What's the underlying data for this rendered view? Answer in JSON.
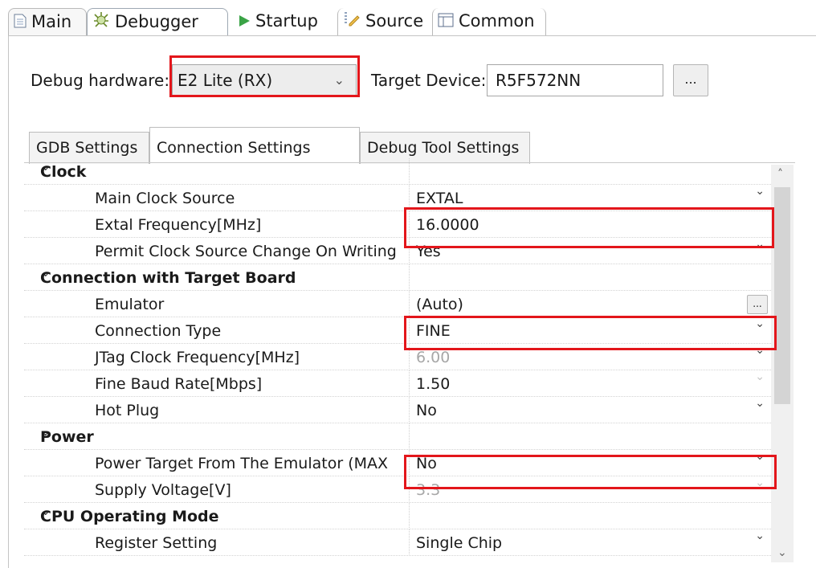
{
  "top_tabs": [
    {
      "label": "Main",
      "icon": "document-icon"
    },
    {
      "label": "Debugger",
      "icon": "bug-icon"
    },
    {
      "label": "Startup",
      "icon": "play-icon"
    },
    {
      "label": "Source",
      "icon": "source-icon"
    },
    {
      "label": "Common",
      "icon": "table-icon"
    }
  ],
  "debug_hardware": {
    "label": "Debug hardware:",
    "value": "E2 Lite (RX)"
  },
  "target_device": {
    "label": "Target Device:",
    "value": "R5F572NN",
    "browse": "..."
  },
  "sub_tabs": [
    "GDB Settings",
    "Connection Settings",
    "Debug Tool Settings"
  ],
  "properties": {
    "clock": {
      "label": "Clock",
      "main_clock_source": {
        "name": "Main Clock Source",
        "value": "EXTAL"
      },
      "extal_frequency": {
        "name": "Extal Frequency[MHz]",
        "value": "16.0000"
      },
      "permit_clock_change": {
        "name": "Permit Clock Source Change On Writing",
        "value": "Yes"
      }
    },
    "connection": {
      "label": "Connection with Target Board",
      "emulator": {
        "name": "Emulator",
        "value": "(Auto)",
        "browse": "..."
      },
      "connection_type": {
        "name": "Connection Type",
        "value": "FINE"
      },
      "jtag_clock": {
        "name": "JTag Clock Frequency[MHz]",
        "value": "6.00"
      },
      "fine_baud": {
        "name": "Fine Baud Rate[Mbps]",
        "value": "1.50"
      },
      "hot_plug": {
        "name": "Hot Plug",
        "value": "No"
      }
    },
    "power": {
      "label": "Power",
      "power_target": {
        "name": "Power Target From The Emulator (MAX",
        "value": "No"
      },
      "supply_voltage": {
        "name": "Supply Voltage[V]",
        "value": "3.3"
      }
    },
    "cpu_mode": {
      "label": "CPU Operating Mode",
      "register_setting": {
        "name": "Register Setting",
        "value": "Single Chip"
      }
    }
  },
  "colors": {
    "highlight": "#e3161b",
    "disabled_text": "#a7a7a7"
  }
}
